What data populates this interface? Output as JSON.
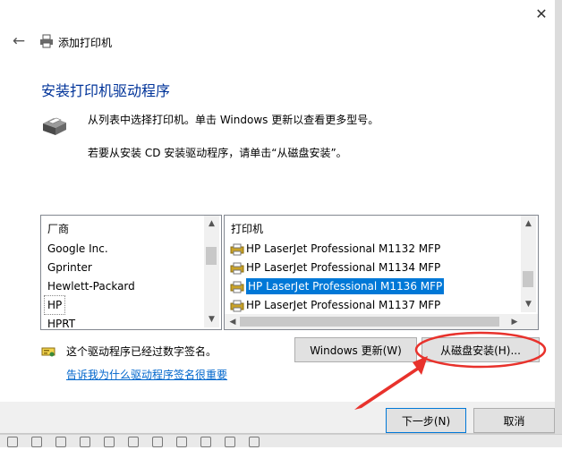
{
  "window": {
    "title": "添加打印机",
    "close_glyph": "✕",
    "back_glyph": "←"
  },
  "header": {
    "heading": "安装打印机驱动程序",
    "desc1": "从列表中选择打印机。单击 Windows 更新以查看更多型号。",
    "desc2": "若要从安装 CD 安装驱动程序，请单击“从磁盘安装”。"
  },
  "manufacturers": {
    "header": "厂商",
    "items": [
      "Google Inc.",
      "Gprinter",
      "Hewlett-Packard",
      "HP",
      "HPRT"
    ],
    "selected": "HP"
  },
  "printers": {
    "header": "打印机",
    "items": [
      "HP LaserJet Professional M1132 MFP",
      "HP LaserJet Professional M1134 MFP",
      "HP LaserJet Professional M1136 MFP",
      "HP LaserJet Professional M1137 MFP"
    ],
    "selected": "HP LaserJet Professional M1136 MFP"
  },
  "buttons": {
    "windows_update": "Windows 更新(W)",
    "have_disk": "从磁盘安装(H)...",
    "next": "下一步(N)",
    "cancel": "取消"
  },
  "signature": {
    "text": "这个驱动程序已经过数字签名。",
    "link": "告诉我为什么驱动程序签名很重要"
  },
  "colors": {
    "accent": "#0078d7",
    "heading": "#003399",
    "link": "#0066cc",
    "annotation": "#e8322c"
  },
  "icons": {
    "printer": "printer-icon",
    "signed": "signed-driver-icon",
    "annotation": "red-arrow-annotation"
  }
}
